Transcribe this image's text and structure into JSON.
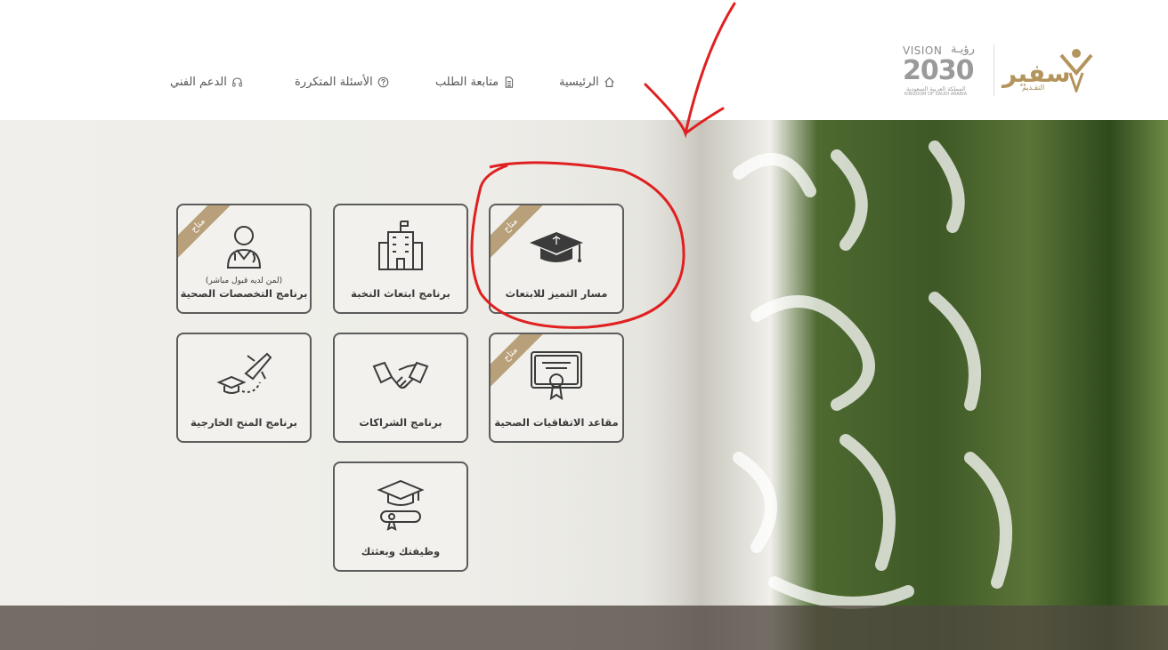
{
  "nav": {
    "home": "الرئيسية",
    "track": "متابعة الطلب",
    "faq": "الأسئلة المتكررة",
    "support": "الدعم الفني"
  },
  "logos": {
    "vision_word": "VISION",
    "vision_ar": "رؤيـة",
    "vision_num": "2030",
    "vision_sub_ar": "المملكة العربية السعودية",
    "vision_sub_en": "KINGDOM OF SAUDI ARABIA",
    "safeer_word": "سفير",
    "safeer_sub": "التقـديم"
  },
  "ribbon_text": "متاح",
  "cards": [
    {
      "label": "برنامج التخصصات الصحية",
      "sublabel": "(لمن لديه قبول مباشر)",
      "icon": "doctor-icon",
      "available": true
    },
    {
      "label": "برنامج ابتعاث النخبة",
      "icon": "building-icon",
      "available": false
    },
    {
      "label": "مسار التميز للابتعاث",
      "icon": "graduation-cap-icon",
      "available": true
    },
    {
      "label": "برنامج المنح الخارجية",
      "icon": "plane-icon",
      "available": false
    },
    {
      "label": "برنامج الشراكات",
      "icon": "handshake-icon",
      "available": false
    },
    {
      "label": "مقاعد الاتفاقيات الصحية",
      "icon": "certificate-icon",
      "available": true
    },
    {
      "label": "وظيفتك وبعثتك",
      "icon": "diploma-icon",
      "available": false
    }
  ],
  "colors": {
    "card_border": "#5c5c5c",
    "ribbon": "#b8a07a",
    "brand_gold": "#b3945d",
    "annotation_red": "#e02020"
  }
}
